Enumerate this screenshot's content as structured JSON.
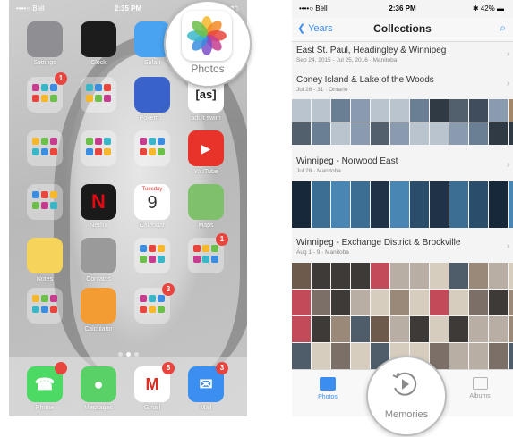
{
  "home": {
    "status": {
      "carrier": "••••○ Bell",
      "time": "2:35 PM"
    },
    "apps": [
      {
        "name": "settings",
        "label": "Settings",
        "color": "#8e8e93",
        "badge": ""
      },
      {
        "name": "clock",
        "label": "Clock",
        "color": "#1c1c1c",
        "badge": ""
      },
      {
        "name": "safari",
        "label": "Safari",
        "color": "#4aa3f0",
        "badge": ""
      },
      {
        "name": "folder-1",
        "label": "",
        "color": "",
        "badge": "2"
      },
      {
        "name": "folder-2",
        "label": "",
        "color": "",
        "badge": "1"
      },
      {
        "name": "folder-3",
        "label": "",
        "color": "",
        "badge": ""
      },
      {
        "name": "pokemon",
        "label": "Pokém…",
        "color": "#3a63c9",
        "badge": ""
      },
      {
        "name": "adult-swim",
        "label": "adult swim",
        "color": "#ffffff",
        "badge": ""
      },
      {
        "name": "folder-4",
        "label": "",
        "color": "",
        "badge": ""
      },
      {
        "name": "folder-5",
        "label": "",
        "color": "",
        "badge": ""
      },
      {
        "name": "folder-6",
        "label": "",
        "color": "",
        "badge": ""
      },
      {
        "name": "youtube",
        "label": "YouTube",
        "color": "#e8332a",
        "badge": ""
      },
      {
        "name": "folder-7",
        "label": "",
        "color": "",
        "badge": ""
      },
      {
        "name": "netflix",
        "label": "Netflix",
        "color": "#1a1a1a",
        "badge": ""
      },
      {
        "name": "calendar",
        "label": "Calendar",
        "color": "#ffffff",
        "badge": ""
      },
      {
        "name": "maps",
        "label": "Maps",
        "color": "#7fc06a",
        "badge": ""
      },
      {
        "name": "notes",
        "label": "Notes",
        "color": "#f6d35a",
        "badge": ""
      },
      {
        "name": "contacts",
        "label": "Contacts",
        "color": "#9a9a9a",
        "badge": ""
      },
      {
        "name": "folder-8",
        "label": "",
        "color": "",
        "badge": ""
      },
      {
        "name": "folder-9",
        "label": "",
        "color": "",
        "badge": "1"
      },
      {
        "name": "folder-10",
        "label": "",
        "color": "",
        "badge": ""
      },
      {
        "name": "calculator",
        "label": "Calculator",
        "color": "#f39c33",
        "badge": ""
      },
      {
        "name": "folder-11",
        "label": "",
        "color": "",
        "badge": "3"
      }
    ],
    "calendar": {
      "day": "Tuesday",
      "date": "9"
    },
    "dock": [
      {
        "name": "phone",
        "label": "Phone",
        "color": "#4cd964",
        "badge": " "
      },
      {
        "name": "messages",
        "label": "Messages",
        "color": "#5ad167",
        "badge": ""
      },
      {
        "name": "gmail",
        "label": "Gmail",
        "color": "#ffffff",
        "badge": "5"
      },
      {
        "name": "mail",
        "label": "Mail",
        "color": "#3a8ff0",
        "badge": "3"
      }
    ],
    "zoom_label": "Photos"
  },
  "collections": {
    "status": {
      "carrier": "••••○ Bell",
      "time": "2:36 PM",
      "battery": "42%"
    },
    "nav": {
      "back": "Years",
      "title": "Collections"
    },
    "sections": [
      {
        "title": "East St. Paul, Headingley & Winnipeg",
        "subtitle": "Sep 24, 2015 - Jul 25, 2016 · Manitoba"
      },
      {
        "title": "Coney Island & Lake of the Woods",
        "subtitle": "Jul 26 - 31 · Ontario"
      },
      {
        "title": "Winnipeg - Norwood East",
        "subtitle": "Jul 28 · Manitoba"
      },
      {
        "title": "Winnipeg - Exchange District & Brockville",
        "subtitle": "Aug 1 - 9 · Manitoba"
      }
    ],
    "tabs": [
      {
        "label": "Photos",
        "color": "#3b8ef0"
      },
      {
        "label": "Memories",
        "color": "#8a8a8a"
      },
      {
        "label": "Albums",
        "color": "#9a9a9a"
      }
    ]
  }
}
